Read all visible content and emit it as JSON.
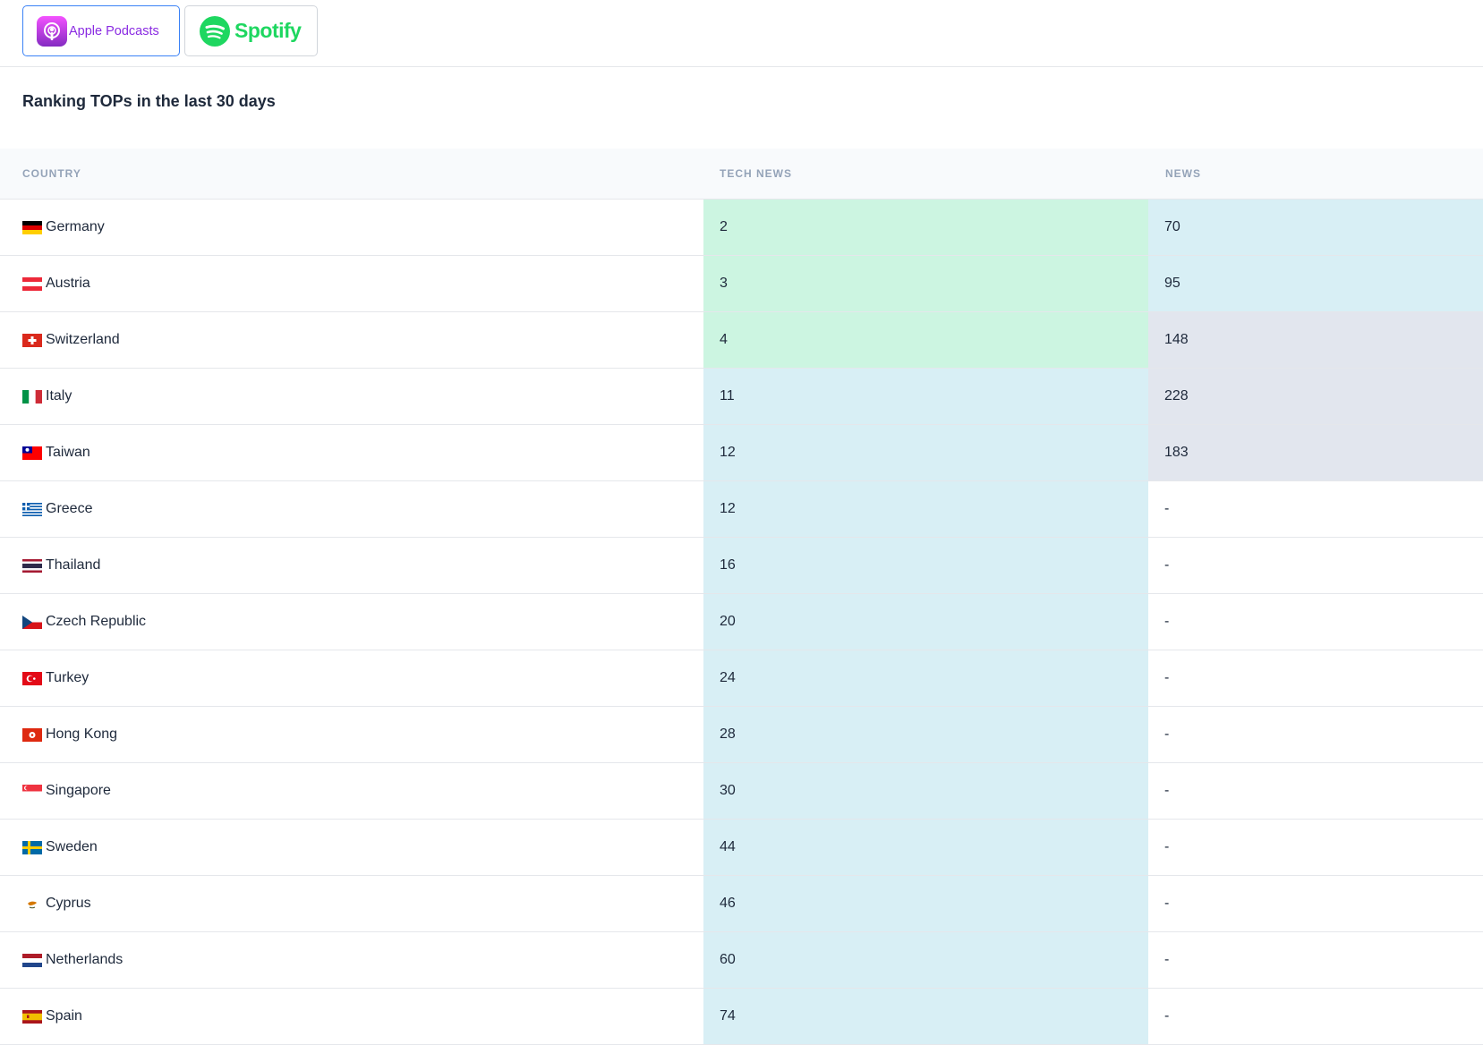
{
  "platforms": {
    "apple_label": "Apple Podcasts",
    "spotify_label": "Spotify",
    "active": "Apple Podcasts"
  },
  "title": "Ranking TOPs in the last 30 days",
  "table": {
    "headers": {
      "country": "COUNTRY",
      "tech_news": "TECH NEWS",
      "news": "NEWS"
    },
    "rows": [
      {
        "flag": "de",
        "country": "Germany",
        "tech_news": "2",
        "news": "70"
      },
      {
        "flag": "at",
        "country": "Austria",
        "tech_news": "3",
        "news": "95"
      },
      {
        "flag": "ch",
        "country": "Switzerland",
        "tech_news": "4",
        "news": "148"
      },
      {
        "flag": "it",
        "country": "Italy",
        "tech_news": "11",
        "news": "228"
      },
      {
        "flag": "tw",
        "country": "Taiwan",
        "tech_news": "12",
        "news": "183"
      },
      {
        "flag": "gr",
        "country": "Greece",
        "tech_news": "12",
        "news": "-"
      },
      {
        "flag": "th",
        "country": "Thailand",
        "tech_news": "16",
        "news": "-"
      },
      {
        "flag": "cz",
        "country": "Czech Republic",
        "tech_news": "20",
        "news": "-"
      },
      {
        "flag": "tr",
        "country": "Turkey",
        "tech_news": "24",
        "news": "-"
      },
      {
        "flag": "hk",
        "country": "Hong Kong",
        "tech_news": "28",
        "news": "-"
      },
      {
        "flag": "sg",
        "country": "Singapore",
        "tech_news": "30",
        "news": "-"
      },
      {
        "flag": "se",
        "country": "Sweden",
        "tech_news": "44",
        "news": "-"
      },
      {
        "flag": "cy",
        "country": "Cyprus",
        "tech_news": "46",
        "news": "-"
      },
      {
        "flag": "nl",
        "country": "Netherlands",
        "tech_news": "60",
        "news": "-"
      },
      {
        "flag": "es",
        "country": "Spain",
        "tech_news": "74",
        "news": "-"
      }
    ]
  },
  "colors": {
    "rank_top": "#ccf5e1",
    "rank_mid": "#d8eff5",
    "rank_low": "#e2e6ee"
  }
}
